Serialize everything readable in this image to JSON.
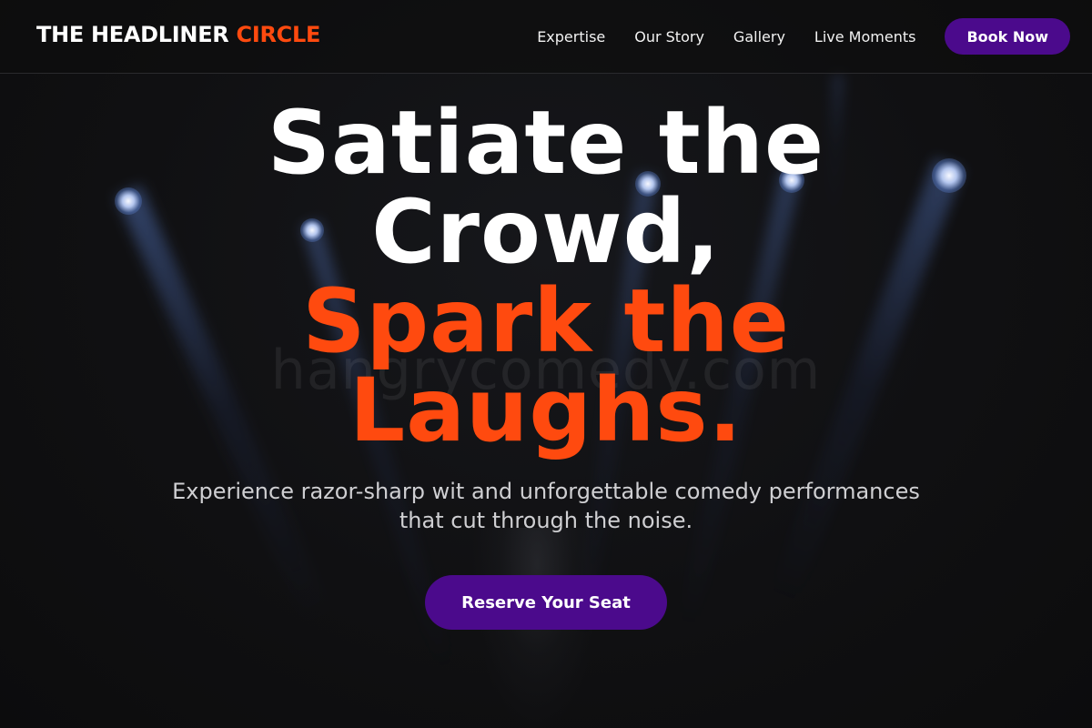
{
  "brand": {
    "name_part1": "THE HEADLINER",
    "name_part2": "CIRCLE"
  },
  "nav": {
    "links": [
      "Expertise",
      "Our Story",
      "Gallery",
      "Live Moments"
    ],
    "book_label": "Book Now"
  },
  "hero": {
    "line1": "Satiate the",
    "line2": "Crowd,",
    "line3": "Spark the",
    "line4": "Laughs.",
    "subtitle_line1": "Experience razor-sharp wit and unforgettable comedy performances",
    "subtitle_line2": "that cut through the noise.",
    "cta_label": "Reserve Your Seat",
    "watermark": "hangrycomedy.com"
  },
  "colors": {
    "accent_orange": "#ff4a0f",
    "button_purple": "#4b0a8c",
    "background": "#0e0e0f"
  }
}
